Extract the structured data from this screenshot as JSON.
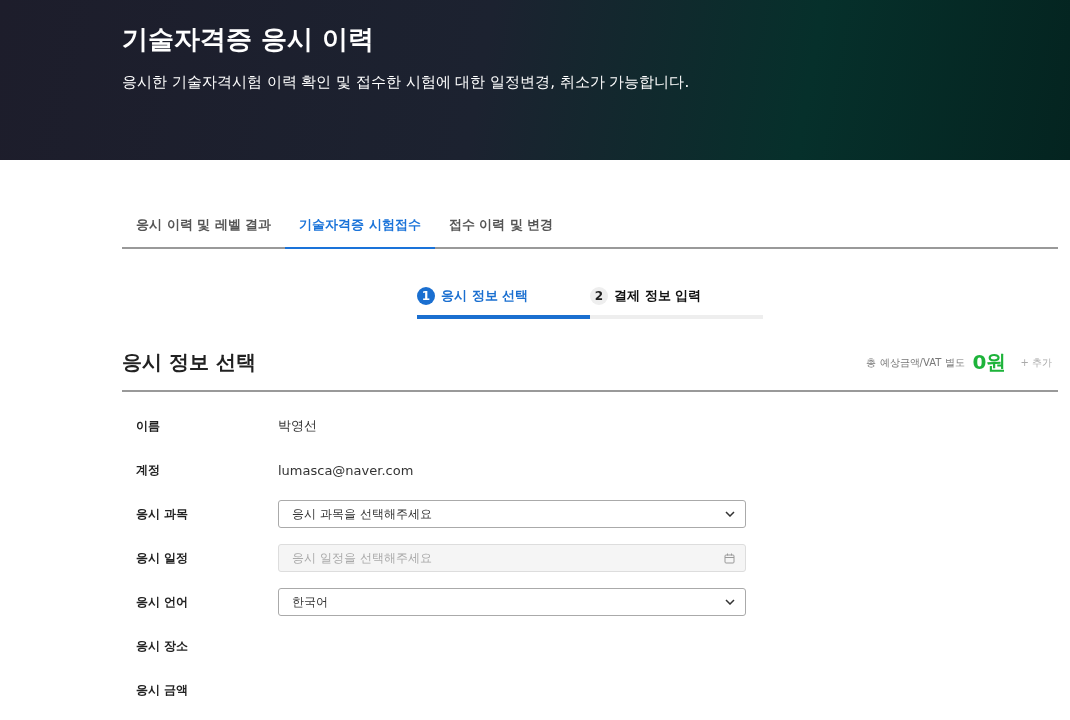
{
  "header": {
    "title": "기술자격증 응시 이력",
    "subtitle": "응시한 기술자격시험 이력 확인 및 접수한 시험에 대한 일정변경, 취소가 가능합니다."
  },
  "tabs": [
    {
      "label": "응시 이력 및 레벨 결과",
      "selected": false
    },
    {
      "label": "기술자격증 시험접수",
      "selected": true
    },
    {
      "label": "접수 이력 및 변경",
      "selected": false
    }
  ],
  "steps": [
    {
      "number": "1",
      "label": "응시 정보 선택",
      "selected": true
    },
    {
      "number": "2",
      "label": "결제 정보 입력",
      "selected": false
    }
  ],
  "section": {
    "title": "응시 정보 선택",
    "total_label": "총 예상금액/VAT 별도",
    "total": "0원",
    "add": "+ 추가"
  },
  "fields": [
    {
      "label": "이름",
      "kind": "text",
      "value": "박영선"
    },
    {
      "label": "계정",
      "kind": "text",
      "value": "lumasca@naver.com"
    },
    {
      "label": "응시 과목",
      "kind": "select",
      "value": "응시 과목을 선택해주세요"
    },
    {
      "label": "응시 일정",
      "kind": "date",
      "placeholder": "응시 일정을 선택해주세요",
      "disabled": true
    },
    {
      "label": "응시 언어",
      "kind": "select",
      "value": "한국어"
    },
    {
      "label": "응시 장소",
      "kind": "empty"
    },
    {
      "label": "응시 금액",
      "kind": "empty"
    }
  ]
}
